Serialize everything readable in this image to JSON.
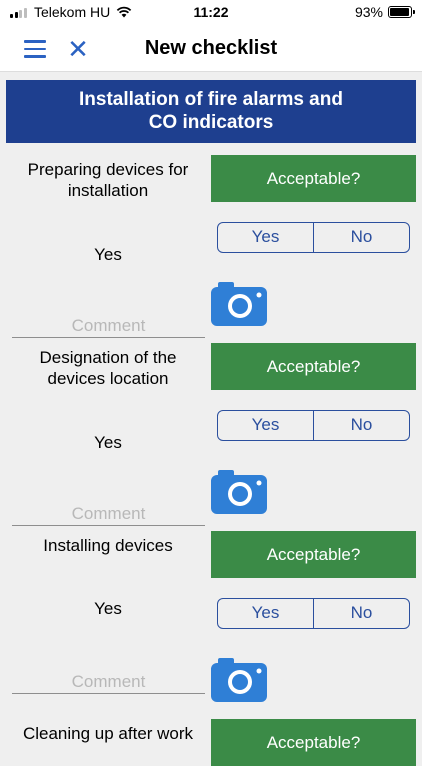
{
  "status": {
    "carrier": "Telekom HU",
    "time": "11:22",
    "battery": "93%",
    "battery_level": 0.93
  },
  "nav": {
    "title": "New checklist",
    "menu_icon": "hamburger-menu-icon",
    "close_icon": "close-icon"
  },
  "section": {
    "title_line1": "Installation of fire alarms and",
    "title_line2": "CO indicators"
  },
  "colors": {
    "header_bg": "#1e3f8f",
    "accent": "#2b62c2",
    "acceptable_bg": "#3b8b47"
  },
  "items": [
    {
      "title": "Preparing devices for installation",
      "acceptable_label": "Acceptable?",
      "answer": "Yes",
      "yes_label": "Yes",
      "no_label": "No",
      "comment_placeholder": "Comment"
    },
    {
      "title": "Designation of the devices location",
      "acceptable_label": "Acceptable?",
      "answer": "Yes",
      "yes_label": "Yes",
      "no_label": "No",
      "comment_placeholder": "Comment"
    },
    {
      "title": "Installing devices",
      "acceptable_label": "Acceptable?",
      "answer": "Yes",
      "yes_label": "Yes",
      "no_label": "No",
      "comment_placeholder": "Comment"
    },
    {
      "title": "Cleaning up after work",
      "acceptable_label": "Acceptable?"
    }
  ]
}
